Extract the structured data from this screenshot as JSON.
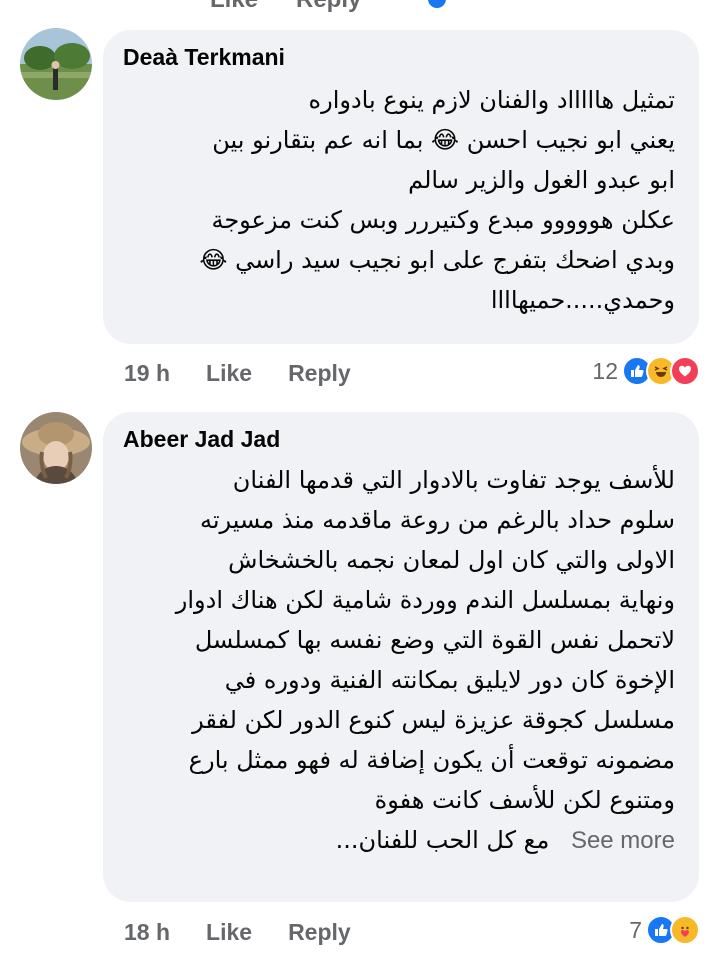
{
  "comments": [
    {
      "author": "Deaà Terkmani",
      "lines": [
        "تمثيل هاااااد والفنان لازم ينوع بادواره",
        "يعني ابو نجيب احسن 😂 بما انه عم بتقارنو بين",
        "ابو عبدو الغول والزير سالم",
        "عكلن هووووو مبدع وكتيررر وبس كنت مزعوجة",
        "وبدي اضحك بتفرج على ابو نجيب سيد راسي 😂",
        "وحمدي.....حميهاااا"
      ],
      "time": "19 h",
      "like_label": "Like",
      "reply_label": "Reply",
      "reaction_count": "12",
      "reactions": [
        "like-icon",
        "haha-icon",
        "love-icon"
      ]
    },
    {
      "author": "Abeer Jad Jad",
      "lines": [
        "للأسف يوجد تفاوت بالادوار التي قدمها الفنان",
        "سلوم حداد بالرغم من روعة ماقدمه منذ مسيرته",
        "الاولى والتي  كان اول لمعان نجمه بالخشخاش",
        "ونهاية بمسلسل الندم ووردة شامية لكن هناك ادوار",
        "لاتحمل نفس القوة التي وضع نفسه بها كمسلسل",
        "الإخوة  كان دور لايليق  بمكانته الفنية ودوره في",
        "مسلسل كجوقة عزيزة ليس كنوع الدور  لكن لفقر",
        "مضمونه توقعت أن يكون إضافة له  فهو ممثل بارع",
        "ومتنوع لكن للأسف كانت هفوة",
        "مع كل الحب للفنان..."
      ],
      "see_more": "See more",
      "time": "18 h",
      "like_label": "Like",
      "reply_label": "Reply",
      "reaction_count": "7",
      "reactions": [
        "like-icon",
        "care-icon"
      ]
    }
  ],
  "top_partial": {
    "like_label": "Like",
    "reply_label": "Reply"
  }
}
